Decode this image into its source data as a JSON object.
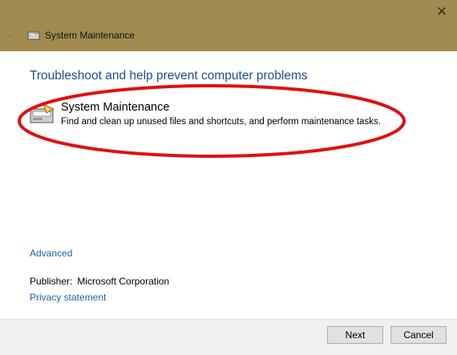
{
  "window": {
    "title": "System Maintenance",
    "close_glyph": "✕",
    "back_glyph": "←",
    "titlebar_color": "#a08a50"
  },
  "main": {
    "heading": "Troubleshoot and help prevent computer problems",
    "item": {
      "title": "System Maintenance",
      "description": "Find and clean up unused files and shortcuts, and perform maintenance tasks.",
      "icon": "system-maintenance-icon"
    },
    "advanced_link": "Advanced",
    "publisher_label": "Publisher:",
    "publisher_value": "Microsoft Corporation",
    "privacy_link": "Privacy statement",
    "annotation_color": "#e01010"
  },
  "footer": {
    "next_label": "Next",
    "cancel_label": "Cancel"
  }
}
